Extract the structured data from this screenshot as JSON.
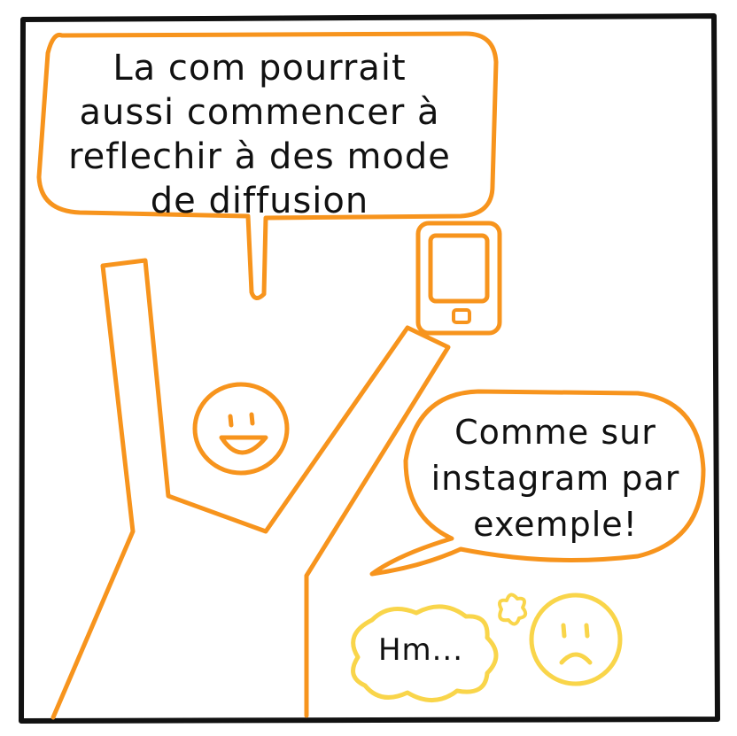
{
  "comic": {
    "bubble_top": {
      "lines": [
        "La com pourrait",
        "aussi commencer à",
        "reflechir à des mode",
        "de diffusion"
      ]
    },
    "bubble_right": {
      "lines": [
        "Comme sur",
        "instagram par",
        "exemple!"
      ]
    },
    "thought": {
      "text": "Hm..."
    },
    "colors": {
      "border": "#111111",
      "orange": "#F7941D",
      "yellow": "#F9D54A",
      "text": "#111111"
    },
    "icons": {
      "phone": "smartphone-icon",
      "happy": "smiley-face-icon",
      "sad": "sad-face-icon",
      "sparkle": "sparkle-icon"
    }
  }
}
